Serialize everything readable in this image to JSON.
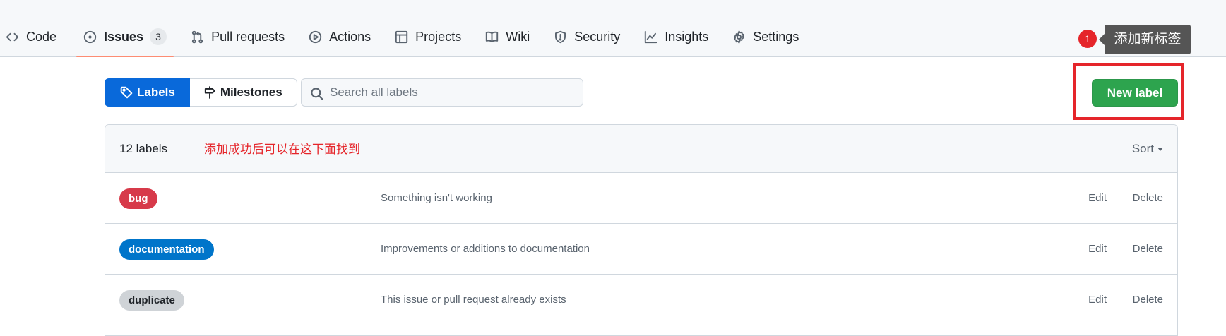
{
  "repo_nav": {
    "items": [
      {
        "label": "Code",
        "icon": "code-icon"
      },
      {
        "label": "Issues",
        "icon": "issue-opened-icon",
        "counter": "3",
        "selected": true
      },
      {
        "label": "Pull requests",
        "icon": "git-pull-request-icon"
      },
      {
        "label": "Actions",
        "icon": "play-icon"
      },
      {
        "label": "Projects",
        "icon": "table-icon"
      },
      {
        "label": "Wiki",
        "icon": "book-icon"
      },
      {
        "label": "Security",
        "icon": "shield-icon"
      },
      {
        "label": "Insights",
        "icon": "graph-icon"
      },
      {
        "label": "Settings",
        "icon": "gear-icon"
      }
    ]
  },
  "annotation": {
    "step": "1",
    "tooltip": "添加新标签",
    "note": "添加成功后可以在这下面找到",
    "color": "#e5252a"
  },
  "subnav": {
    "labels": "Labels",
    "milestones": "Milestones"
  },
  "search": {
    "placeholder": "Search all labels"
  },
  "new_label_button": "New label",
  "list": {
    "count_text": "12 labels",
    "sort": "Sort",
    "rows": [
      {
        "name": "bug",
        "description": "Something isn't working",
        "color": "#d73a4a",
        "text_color": "#ffffff"
      },
      {
        "name": "documentation",
        "description": "Improvements or additions to documentation",
        "color": "#0075ca",
        "text_color": "#ffffff"
      },
      {
        "name": "duplicate",
        "description": "This issue or pull request already exists",
        "color": "#cfd3d7",
        "text_color": "#1f2328"
      }
    ],
    "edit_label": "Edit",
    "delete_label": "Delete"
  },
  "colors": {
    "accent_blue": "#0969da",
    "primary_green": "#2da44e",
    "selected_underline": "#fd8c73"
  }
}
